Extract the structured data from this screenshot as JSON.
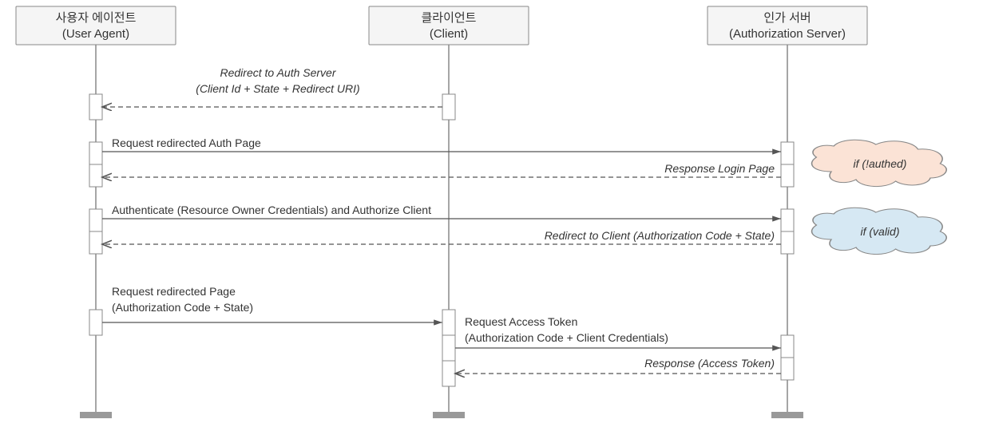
{
  "actors": {
    "ua": {
      "kr": "사용자 에이전트",
      "en": "(User Agent)"
    },
    "cl": {
      "kr": "클라이언트",
      "en": "(Client)"
    },
    "as": {
      "kr": "인가 서버",
      "en": "(Authorization Server)"
    }
  },
  "messages": {
    "m1a": "Redirect to Auth Server",
    "m1b": "(Client Id + State + Redirect URI)",
    "m2": "Request redirected Auth Page",
    "m3": "Response Login Page",
    "m4": "Authenticate (Resource Owner Credentials) and Authorize Client",
    "m5": "Redirect  to Client (Authorization Code + State)",
    "m6a": "Request redirected Page",
    "m6b": "(Authorization Code + State)",
    "m7a": "Request Access Token",
    "m7b": "(Authorization Code + Client Credentials)",
    "m8": "Response  (Access Token)"
  },
  "notes": {
    "n1": "if (!authed)",
    "n2": "if (valid)"
  }
}
